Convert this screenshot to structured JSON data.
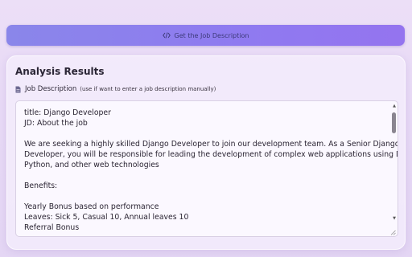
{
  "top_button": {
    "label": "Get the Job Description",
    "icon": "code-icon"
  },
  "panel": {
    "title": "Analysis Results",
    "jd_label": "Job Description",
    "jd_hint": "(use if want to enter a job description manually)",
    "jd_icon": "document-icon",
    "textarea_lines": [
      "title: Django Developer",
      "JD: About the job",
      "",
      "We are seeking a highly skilled Django Developer to join our development team. As a Senior Django",
      "Developer, you will be responsible for leading the development of complex web applications using Django,",
      "Python, and other web technologies",
      "",
      "Benefits:",
      "",
      "Yearly Bonus based on performance",
      "Leaves: Sick 5, Casual 10, Annual leaves 10",
      "Referral Bonus"
    ]
  },
  "colors": {
    "accent_start": "#8a86ea",
    "accent_end": "#9474ef"
  }
}
